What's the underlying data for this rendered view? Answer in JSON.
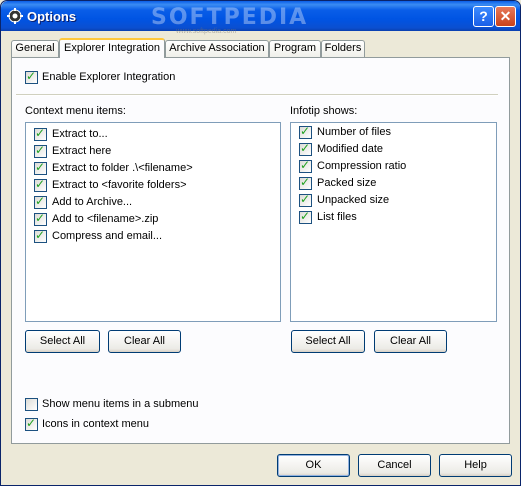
{
  "window": {
    "title": "Options",
    "watermark": "SOFTPEDIA",
    "watermark_url": "www.softpedia.com"
  },
  "titlebar_buttons": {
    "help": "?",
    "close": "✕"
  },
  "tabs": [
    {
      "label": "General"
    },
    {
      "label": "Explorer Integration",
      "active": true
    },
    {
      "label": "Archive Association"
    },
    {
      "label": "Program"
    },
    {
      "label": "Folders"
    }
  ],
  "enable_integration": {
    "label": "Enable Explorer Integration",
    "checked": true
  },
  "context_menu": {
    "label": "Context menu items:",
    "items": [
      {
        "label": "Extract to...",
        "checked": true
      },
      {
        "label": "Extract here",
        "checked": true
      },
      {
        "label": "Extract to folder .\\<filename>",
        "checked": true
      },
      {
        "label": "Extract to <favorite folders>",
        "checked": true
      },
      {
        "label": "Add to Archive...",
        "checked": true
      },
      {
        "label": "Add to <filename>.zip",
        "checked": true
      },
      {
        "label": "Compress and email...",
        "checked": true
      }
    ],
    "select_all": "Select All",
    "clear_all": "Clear All"
  },
  "infotip": {
    "label": "Infotip shows:",
    "items": [
      {
        "label": "Number of files",
        "checked": true
      },
      {
        "label": "Modified date",
        "checked": true
      },
      {
        "label": "Compression ratio",
        "checked": true
      },
      {
        "label": "Packed size",
        "checked": true
      },
      {
        "label": "Unpacked size",
        "checked": true
      },
      {
        "label": "List files",
        "checked": true
      }
    ],
    "select_all": "Select All",
    "clear_all": "Clear All"
  },
  "submenu_option": {
    "label": "Show menu items in a submenu",
    "checked": false
  },
  "icons_option": {
    "label": "Icons in context menu",
    "checked": true
  },
  "footer": {
    "ok": "OK",
    "cancel": "Cancel",
    "help": "Help"
  }
}
